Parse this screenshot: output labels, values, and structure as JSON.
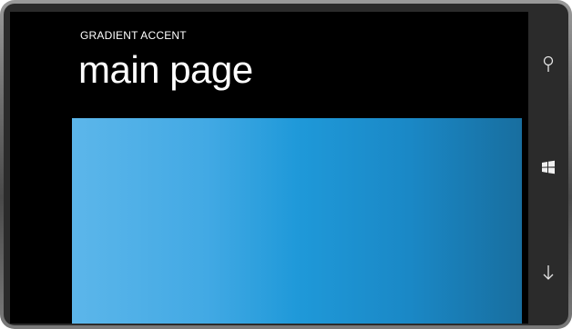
{
  "app": {
    "title": "GRADIENT ACCENT",
    "page_title": "main page"
  },
  "content": {
    "gradient_colors": [
      "#5cb6ea",
      "#1f99d9",
      "#186e9f"
    ]
  },
  "hardware_buttons": [
    {
      "name": "search",
      "icon": "search-icon"
    },
    {
      "name": "start",
      "icon": "windows-logo-icon"
    },
    {
      "name": "back",
      "icon": "back-arrow-icon"
    }
  ],
  "colors": {
    "screen_background": "#000000",
    "text": "#ffffff",
    "accent": "#1f99d9"
  }
}
